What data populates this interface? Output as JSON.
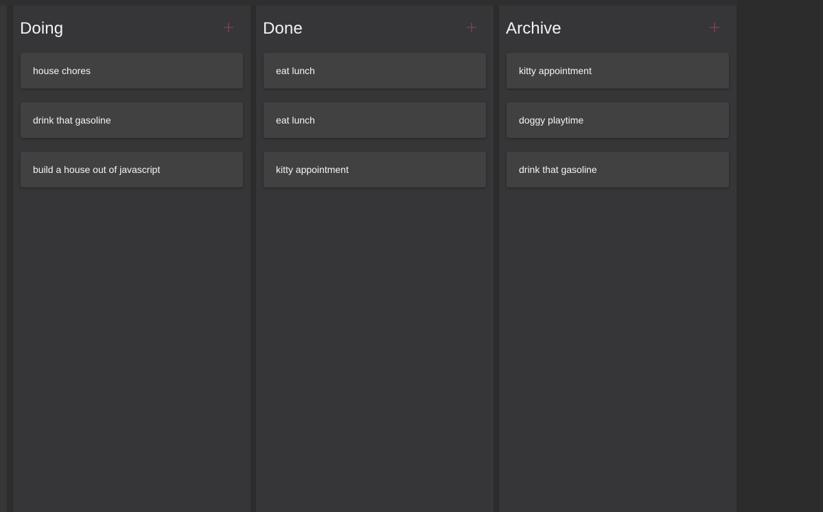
{
  "accent_color": "#7a3d5c",
  "columns": [
    {
      "title": "Doing",
      "add_icon": "plus-icon",
      "cards": [
        "house chores",
        "drink that gasoline",
        "build a house out of javascript"
      ]
    },
    {
      "title": "Done",
      "add_icon": "plus-icon",
      "cards": [
        "eat lunch",
        "eat lunch",
        "kitty appointment"
      ]
    },
    {
      "title": "Archive",
      "add_icon": "plus-icon",
      "cards": [
        "kitty appointment",
        "doggy playtime",
        "drink that gasoline"
      ]
    }
  ]
}
